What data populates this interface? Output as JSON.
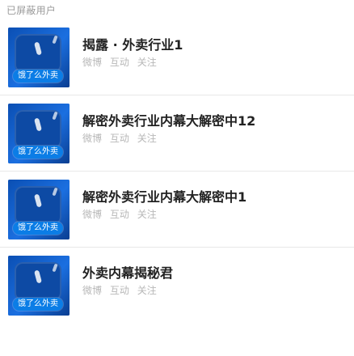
{
  "section": {
    "title": "已屏蔽用户"
  },
  "items": [
    {
      "title": "揭露 · 外卖行业1",
      "meta": [
        "微博",
        "互动",
        "关注"
      ],
      "avatar_tag": "饿了么外卖"
    },
    {
      "title": "解密外卖行业内幕大解密中12",
      "meta": [
        "微博",
        "互动",
        "关注"
      ],
      "avatar_tag": "饿了么外卖"
    },
    {
      "title": "解密外卖行业内幕大解密中1",
      "meta": [
        "微博",
        "互动",
        "关注"
      ],
      "avatar_tag": "饿了么外卖"
    },
    {
      "title": "外卖内幕揭秘君",
      "meta": [
        "微博",
        "互动",
        "关注"
      ],
      "avatar_tag": "饿了么外卖"
    }
  ],
  "colors": {
    "background": "#ffffff",
    "title_text": "#222222",
    "meta_text": "#b8b8b8",
    "section_text": "#9a9a9a",
    "divider": "#e8e8e8",
    "avatar_blue": "#1f63c8",
    "avatar_tag_bg": "#0b7de6"
  },
  "icons": {
    "avatar": "user-avatar-image"
  }
}
